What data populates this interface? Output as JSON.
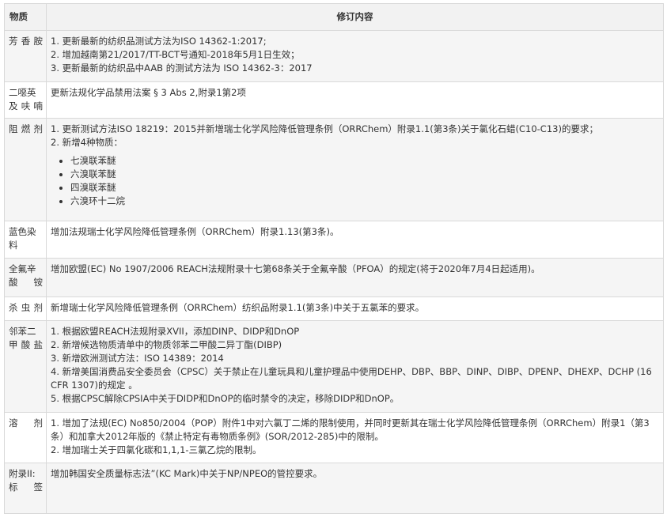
{
  "header": {
    "substance": "物质",
    "content": "修订内容"
  },
  "rows": [
    {
      "substance": "芳香胺",
      "lines": [
        "1. 更新最新的纺织品测试方法为ISO 14362-1:2017;",
        "2. 增加越南第21/2017/TT-BCT号通知-2018年5月1日生效；",
        "3. 更新最新的纺织品中AAB 的测试方法为 ISO 14362-3：2017"
      ]
    },
    {
      "substance": "二噁英及呋喃",
      "lines": [
        "更新法规化学品禁用法案 § 3 Abs 2,附录1第2项"
      ]
    },
    {
      "substance": "阻燃剂",
      "lines": [
        "1. 更新测试方法ISO 18219：2015并新增瑞士化学风险降低管理条例（ORRChem）附录1.1(第3条)关于氯化石蜡(C10-C13)的要求；",
        "2. 新增4种物质："
      ],
      "bullets": [
        "七溴联苯醚",
        "六溴联苯醚",
        "四溴联苯醚",
        "六溴环十二烷"
      ]
    },
    {
      "substance": "蓝色染料",
      "lines": [
        "增加法规瑞士化学风险降低管理条例（ORRChem）附录1.13(第3条)。"
      ]
    },
    {
      "substance": "全氟辛酸铵",
      "lines": [
        "增加欧盟(EC) No 1907/2006 REACH法规附录十七第68条关于全氟辛酸（PFOA）的规定(将于2020年7月4日起适用)。"
      ]
    },
    {
      "substance": "杀虫剂",
      "lines": [
        "新增瑞士化学风险降低管理条例（ORRChem）纺织品附录1.1(第3条)中关于五氯苯的要求。"
      ]
    },
    {
      "substance": "邻苯二甲酸盐",
      "lines": [
        "1. 根据欧盟REACH法规附录XVII，添加DINP、DIDP和DnOP",
        "2. 新增候选物质清单中的物质邻苯二甲酸二异丁酯(DIBP)",
        "3. 新增欧洲测试方法：ISO 14389：2014",
        "4. 新增美国消费品安全委员会（CPSC）关于禁止在儿童玩具和儿童护理品中使用DEHP、DBP、BBP、DINP、DIBP、DPENP、DHEXP、DCHP (16 CFR 1307)的规定 。",
        "5. 根据CPSC解除CPSIA中关于DIDP和DnOP的临时禁令的决定，移除DIDP和DnOP。"
      ]
    },
    {
      "substance": "溶剂",
      "lines": [
        "1. 增加了法规(EC) No850/2004（POP）附件1中对六氯丁二烯的限制使用，并同时更新其在瑞士化学风险降低管理条例（ORRChem）附录1（第3条）和加拿大2012年版的《禁止特定有毒物质条例》(SOR/2012-285)中的限制。",
        "2. 增加瑞士关于四氯化碳和1,1,1-三氯乙烷的限制。"
      ]
    },
    {
      "substance": "附录II: 标签",
      "lines": [
        "增加韩国安全质量标志法”(KC Mark)中关于NP/NPEO的管控要求。"
      ]
    }
  ]
}
